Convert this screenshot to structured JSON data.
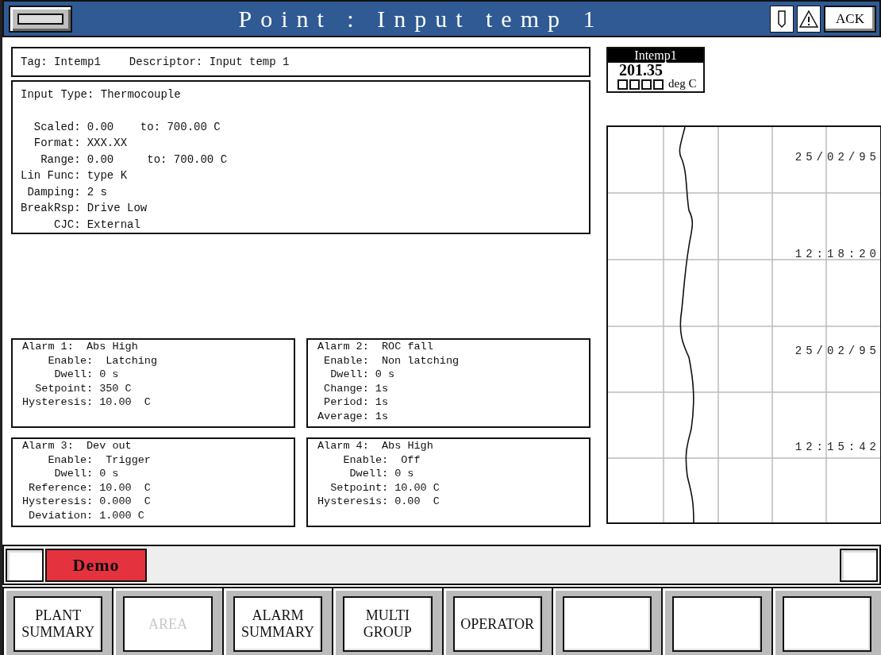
{
  "title_bar": {
    "title": "Point : Input temp 1",
    "ack_label": "ACK"
  },
  "tag_line": {
    "tag": "Tag: Intemp1",
    "descriptor": "Descriptor: Input temp 1"
  },
  "input": {
    "type": "Input Type: Thermocouple",
    "rows": [
      {
        "label": "Scaled:",
        "value": "0.00    to: 700.00 C"
      },
      {
        "label": "Format:",
        "value": "XXX.XX"
      },
      {
        "label": "Range:",
        "value": "0.00     to: 700.00 C"
      },
      {
        "label": "Lin Func:",
        "value": "type K"
      },
      {
        "label": "Damping:",
        "value": "2 s"
      },
      {
        "label": "BreakRsp:",
        "value": "Drive Low"
      },
      {
        "label": "CJC:",
        "value": "External"
      }
    ]
  },
  "alarms": [
    {
      "heading": "Alarm 1:  Abs High",
      "rows": [
        {
          "label": "Enable:",
          "value": " Latching"
        },
        {
          "label": "Dwell:",
          "value": "0 s"
        },
        {
          "label": "Setpoint:",
          "value": "350 C"
        },
        {
          "label": "Hysteresis:",
          "value": "10.00  C"
        }
      ]
    },
    {
      "heading": "Alarm 2:  ROC fall",
      "rows": [
        {
          "label": "Enable:",
          "value": " Non latching"
        },
        {
          "label": "Dwell:",
          "value": "0 s"
        },
        {
          "label": "Change:",
          "value": "1s"
        },
        {
          "label": "Period:",
          "value": "1s"
        },
        {
          "label": "Average:",
          "value": "1s"
        }
      ]
    },
    {
      "heading": "Alarm 3:  Dev out",
      "rows": [
        {
          "label": "Enable:",
          "value": " Trigger"
        },
        {
          "label": "Dwell:",
          "value": "0 s"
        },
        {
          "label": "Reference:",
          "value": "10.00  C"
        },
        {
          "label": "Hysteresis:",
          "value": "0.000  C"
        },
        {
          "label": "Deviation:",
          "value": "1.000 C"
        }
      ]
    },
    {
      "heading": "Alarm 4:  Abs High",
      "rows": [
        {
          "label": "Enable:",
          "value": " Off"
        },
        {
          "label": "Dwell:",
          "value": "0 s"
        },
        {
          "label": "Setpoint:",
          "value": "10.00 C"
        },
        {
          "label": "Hysteresis:",
          "value": "0.00  C"
        }
      ]
    }
  ],
  "readout": {
    "tag": "Intemp1",
    "value": "201.35",
    "unit": "deg C"
  },
  "trend": {
    "labels": [
      "25/02/95",
      "12:18:20",
      "25/02/95",
      "12:15:42"
    ]
  },
  "status_bar": {
    "mode": "Demo"
  },
  "keys": [
    {
      "label": "PLANT\nSUMMARY",
      "disabled": false
    },
    {
      "label": "AREA",
      "disabled": true
    },
    {
      "label": "ALARM\nSUMMARY",
      "disabled": false
    },
    {
      "label": "MULTI\nGROUP",
      "disabled": false
    },
    {
      "label": "OPERATOR",
      "disabled": false
    },
    {
      "disabled": false
    },
    {
      "disabled": false
    },
    {
      "disabled": false
    }
  ]
}
